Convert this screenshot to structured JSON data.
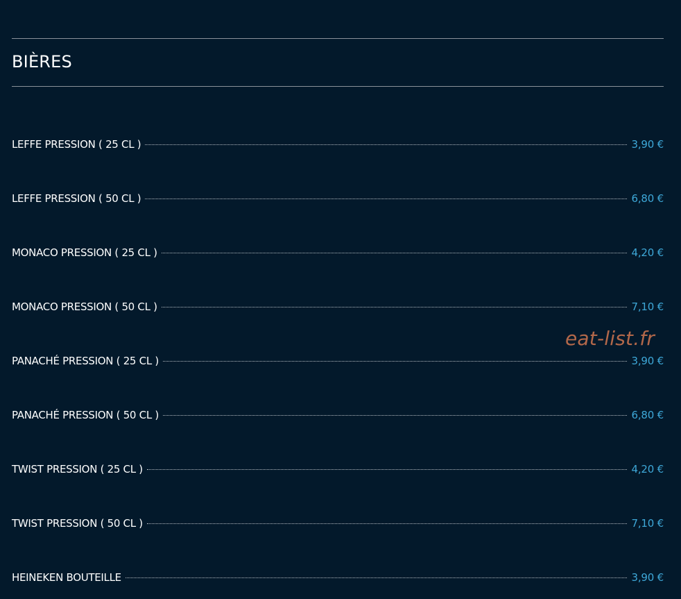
{
  "section": {
    "title": "BIÈRES"
  },
  "menu": {
    "items": [
      {
        "name": "LEFFE PRESSION ( 25 CL )",
        "price": "3,90 €"
      },
      {
        "name": "LEFFE PRESSION ( 50 CL )",
        "price": "6,80 €"
      },
      {
        "name": "MONACO PRESSION ( 25 CL )",
        "price": "4,20 €"
      },
      {
        "name": "MONACO PRESSION ( 50 CL )",
        "price": "7,10 €"
      },
      {
        "name": "PANACHÉ PRESSION ( 25 CL )",
        "price": "3,90 €"
      },
      {
        "name": "PANACHÉ PRESSION ( 50 CL )",
        "price": "6,80 €"
      },
      {
        "name": "TWIST PRESSION ( 25 CL )",
        "price": "4,20 €"
      },
      {
        "name": "TWIST PRESSION ( 50 CL )",
        "price": "7,10 €"
      },
      {
        "name": "HEINEKEN BOUTEILLE",
        "price": "3,90 €"
      }
    ]
  },
  "watermark": {
    "text": "eat-list.fr"
  },
  "colors": {
    "background": "#03192b",
    "text": "#ffffff",
    "price": "#3ea8d8",
    "divider": "#8b929a",
    "watermark": "#b3684a"
  }
}
